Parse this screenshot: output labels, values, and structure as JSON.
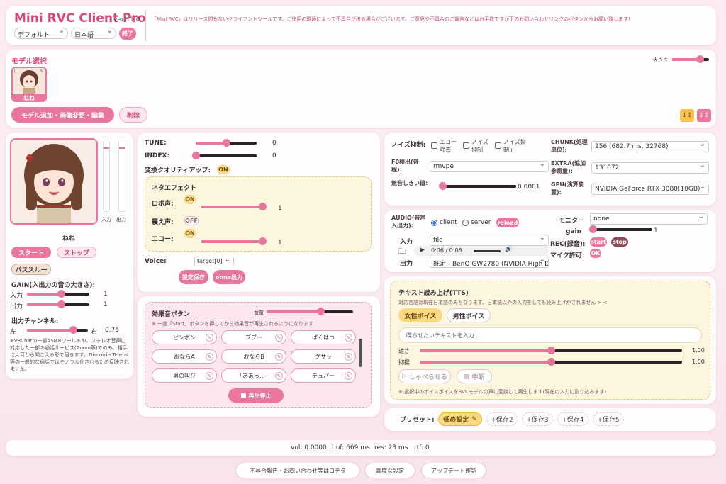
{
  "header": {
    "app_title": "Mini RVC Client Pro",
    "version": "ver1.1.0",
    "notice": "「Mini RVC」はリリース間もないクライアントツールです。ご使用の環境によって不具合が出る場合がございます。ご意見や不具合のご報告などはお手数ですが下のお問い合わせリンクのボタンからお願い致します!",
    "theme_select": "デフォルト",
    "language_select": "日本語",
    "exit_label": "終了"
  },
  "model_select": {
    "heading": "モデル選択",
    "size_label": "大きさ",
    "size_value": 0.75,
    "model_name": "ねね",
    "add_button": "モデル追加・画像変更・編集",
    "delete_button": "削除"
  },
  "character": {
    "name": "ねね",
    "start": "スタート",
    "stop": "ストップ",
    "passthru": "パススルー",
    "meter_in_label": "入力",
    "meter_out_label": "出力",
    "gain_heading": "GAIN(入出力の音の大きさ):",
    "gain_in_label": "入力",
    "gain_in_value": "1",
    "gain_in_level": 0.55,
    "gain_out_label": "出力",
    "gain_out_value": "1",
    "gain_out_level": 0.55,
    "channel_heading": "出力チャンネル:",
    "channel_left": "左",
    "channel_right": "右",
    "channel_value": "0.75",
    "channel_level": 0.75,
    "note": "※VRChatの一部ASMRワールドや、ステレオ音声に対応した一部の通話サービス(Zoom等)でのみ、相手に片耳から聞こえる形で届きます。Discord・Teams等の一般的な通話ではモノラル化されるため反映されません。"
  },
  "tune": {
    "tune_label": "TUNE:",
    "tune_value": "0",
    "tune_level": 0.5,
    "index_label": "INDEX:",
    "index_value": "0",
    "index_level": 0.0,
    "quality_label": "変換クオリティアップ:",
    "quality_state": "ON",
    "neta_heading": "ネタエフェクト",
    "robot_label": "ロボ声:",
    "robot_state": "ON",
    "robot_value": "1",
    "robot_level": 1.0,
    "shake_label": "震え声:",
    "shake_state": "OFF",
    "echo_label": "エコー:",
    "echo_state": "ON",
    "echo_value": "1",
    "echo_level": 1.0,
    "voice_label": "Voice:",
    "voice_value": "target[0]",
    "save_button": "設定保存",
    "onnx_button": "onnx出力"
  },
  "sfx": {
    "heading": "効果音ボタン",
    "volume_label": "音量",
    "volume_level": 0.62,
    "note": "※ 一度「Start」ボタンを押してから効果音が再生されるようになります",
    "buttons": [
      "ピンポン",
      "ブブー",
      "ぱくはつ",
      "おならA",
      "おならB",
      "グサッ",
      "男の叫び",
      "「ああっ…」",
      "チュパー"
    ],
    "stop_button": "再生停止"
  },
  "noise": {
    "noise_label": "ノイズ抑制:",
    "echo_cancel": "エコー除去",
    "noise_suppress": "ノイズ抑制",
    "noise_suppress_plus": "ノイズ抑制+",
    "f0_label": "F0検出(音程):",
    "f0_value": "rmvpe",
    "silence_label": "無音しきい値:",
    "silence_value": "0.0001",
    "silence_level": 0.02,
    "chunk_label": "CHUNK(処理単位):",
    "chunk_value": "256 (682.7 ms, 32768)",
    "extra_label": "EXTRA(追加参照量):",
    "extra_value": "131072",
    "gpu_label": "GPU(演算装置):",
    "gpu_value": "NVIDIA GeForce RTX 3080(10GB)"
  },
  "audio": {
    "audio_label": "AUDIO(音声入出力):",
    "opt_client": "client",
    "opt_server": "server",
    "reload": "reload",
    "input_label": "入力",
    "input_value": "file",
    "time": "0:06 / 0:06",
    "output_label": "出力",
    "output_value": "既定 - BenQ GW2780 (NVIDIA High D",
    "monitor_label": "モニター",
    "monitor_value": "none",
    "gain_label": "gain",
    "gain_value": "1",
    "gain_level": 0.0,
    "rec_label": "REC(録音):",
    "rec_start": "start",
    "rec_stop": "stop",
    "mic_label": "マイク許可:",
    "mic_ok": "OK"
  },
  "tts": {
    "heading": "テキスト読み上げ(TTS)",
    "note": "対応言語は現在日本語のみとなります。日本語以外の入力をしても読み上げがされません > <",
    "female": "女性ボイス",
    "male": "男性ボイス",
    "placeholder": "喋らせたいテキストを入力...",
    "speed_label": "速さ",
    "speed_value": "1.00",
    "speed_level": 0.5,
    "pitch_label": "抑揚",
    "pitch_value": "1.00",
    "pitch_level": 0.5,
    "speak_button": "しゃべらせる",
    "stop_button": "中断",
    "footnote": "※ 選択中のボイスボイスをRVCモデルの声に変換して再生します(現在の入力に割り込みます)"
  },
  "preset": {
    "label": "プリセット:",
    "items": [
      "低め設定",
      "+保存2",
      "+保存3",
      "+保存4",
      "+保存5"
    ]
  },
  "status": {
    "vol": "vol: 0.0000",
    "buf": "buf: 669 ms",
    "res": "res: 23 ms",
    "rtf": "rtf: 0"
  },
  "footer": {
    "report": "不具合報告・お問い合わせ等はコチラ",
    "advanced": "高度な設定",
    "update": "アップデート確認"
  },
  "colors": {
    "accent": "#e9769b",
    "title": "#d9487c",
    "toggle_on": "#fbd980",
    "background": "#fdebef"
  }
}
